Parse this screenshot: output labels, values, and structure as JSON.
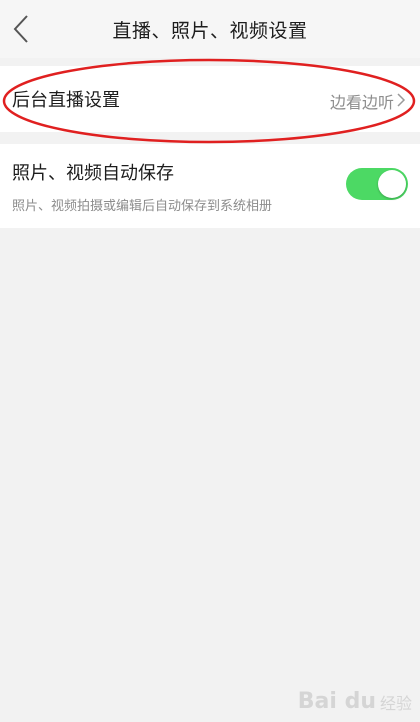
{
  "header": {
    "title": "直播、照片、视频设置",
    "back_icon": "chevron-left-icon"
  },
  "background_live": {
    "label": "后台直播设置",
    "value": "边看边听",
    "chevron_icon": "chevron-right-icon"
  },
  "auto_save": {
    "title": "照片、视频自动保存",
    "description": "照片、视频拍摄或编辑后自动保存到系统相册",
    "enabled": true
  },
  "colors": {
    "toggle_on": "#4cd964",
    "annotation": "#e02020"
  },
  "watermark": {
    "brand": "Bai du",
    "brand_cn": "经验"
  }
}
